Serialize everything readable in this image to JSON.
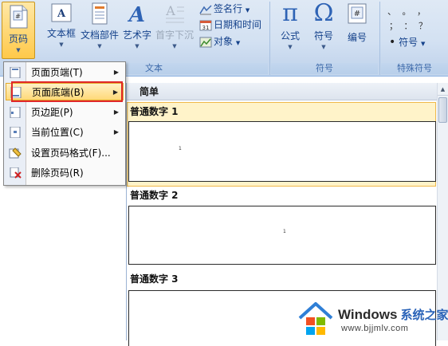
{
  "ribbon": {
    "page_number_label": "页码",
    "buttons": [
      {
        "label": "文本框",
        "icon": "textbox-icon"
      },
      {
        "label": "文档部件",
        "icon": "quick-parts-icon"
      },
      {
        "label": "艺术字",
        "icon": "wordart-icon"
      },
      {
        "label": "首字下沉",
        "icon": "dropcap-icon",
        "disabled": true
      }
    ],
    "small_buttons": [
      "签名行",
      "日期和时间",
      "对象"
    ],
    "text_group_label": "文本",
    "symbols": [
      {
        "label": "公式",
        "glyph": "π"
      },
      {
        "label": "符号",
        "glyph": "Ω"
      },
      {
        "label": "编号",
        "glyph": "#"
      }
    ],
    "symbols_group_label": "符号",
    "special": {
      "dots_row1": "、  。 ，",
      "dots_row2": "；  ：  ？",
      "symbol_btn": "符号",
      "bullet": "•"
    },
    "special_group_label": "特殊符号"
  },
  "menu": {
    "items": [
      {
        "label": "页面页端(T)",
        "has_submenu": true
      },
      {
        "label": "页面底端(B)",
        "has_submenu": true,
        "active": true
      },
      {
        "label": "页边距(P)",
        "has_submenu": true
      },
      {
        "label": "当前位置(C)",
        "has_submenu": true
      },
      {
        "label": "设置页码格式(F)...",
        "has_submenu": false
      },
      {
        "label": "删除页码(R)",
        "has_submenu": false
      }
    ]
  },
  "gallery": {
    "header": "简单",
    "sections": [
      {
        "title": "普通数字 1",
        "sample": "1"
      },
      {
        "title": "普通数字 2",
        "sample": "1"
      },
      {
        "title": "普通数字 3",
        "sample": ""
      }
    ]
  },
  "watermark": {
    "title": "Windows",
    "subtitle": "系统之家",
    "url": "www.bjjmlv.com"
  },
  "colors": {
    "ribbon": "#d3e1f2",
    "highlight": "#ffd978",
    "red_frame": "#e0282a",
    "link_blue": "#15428b"
  }
}
